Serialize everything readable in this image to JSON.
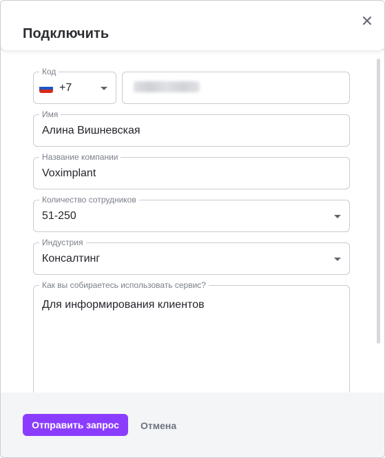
{
  "dialog": {
    "title": "Подключить",
    "close_icon": "close-icon"
  },
  "form": {
    "code": {
      "label": "Код",
      "value": "+7",
      "flag": "russia-flag-icon"
    },
    "phone": {
      "value_obscured": true
    },
    "name": {
      "label": "Имя",
      "value": "Алина Вишневская"
    },
    "company": {
      "label": "Название компании",
      "value": "Voximplant"
    },
    "employees": {
      "label": "Количество сотрудников",
      "value": "51-250"
    },
    "industry": {
      "label": "Индустрия",
      "value": "Консалтинг"
    },
    "usage": {
      "label": "Как вы собираетесь использовать сервис?",
      "value": "Для информирования клиентов"
    }
  },
  "footer": {
    "submit_label": "Отправить запрос",
    "cancel_label": "Отмена"
  },
  "colors": {
    "accent": "#8b3dff",
    "border": "#c8cbd2",
    "footer_bg": "#f4f5f7"
  }
}
